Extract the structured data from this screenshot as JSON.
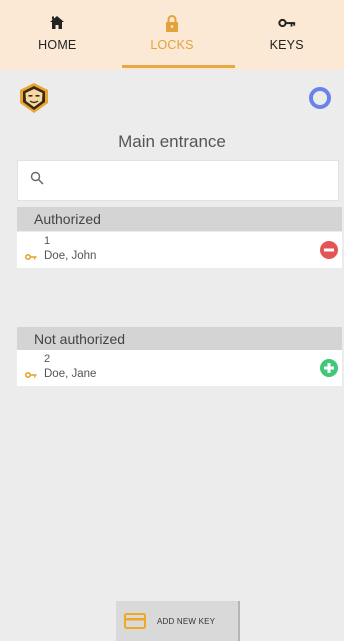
{
  "nav": {
    "tabs": [
      {
        "label": "HOME",
        "icon": "home-icon"
      },
      {
        "label": "LOCKS",
        "icon": "lock-icon",
        "active": true
      },
      {
        "label": "KEYS",
        "icon": "key-icon"
      }
    ]
  },
  "header": {
    "title": "Main entrance"
  },
  "search": {
    "value": "",
    "placeholder": ""
  },
  "sections": [
    {
      "title": "Authorized",
      "entries": [
        {
          "number": "1",
          "name": "Doe, John",
          "action": "remove"
        }
      ]
    },
    {
      "title": "Not authorized",
      "entries": [
        {
          "number": "2",
          "name": "Doe, Jane",
          "action": "add"
        }
      ]
    }
  ],
  "footer": {
    "add_key_label": "ADD NEW KEY"
  },
  "colors": {
    "accent": "#e8a945",
    "nav_bg": "#fbe9d6",
    "remove": "#e25554",
    "add": "#41c77a",
    "ring": "#6a83ea",
    "key": "#e8a530"
  }
}
